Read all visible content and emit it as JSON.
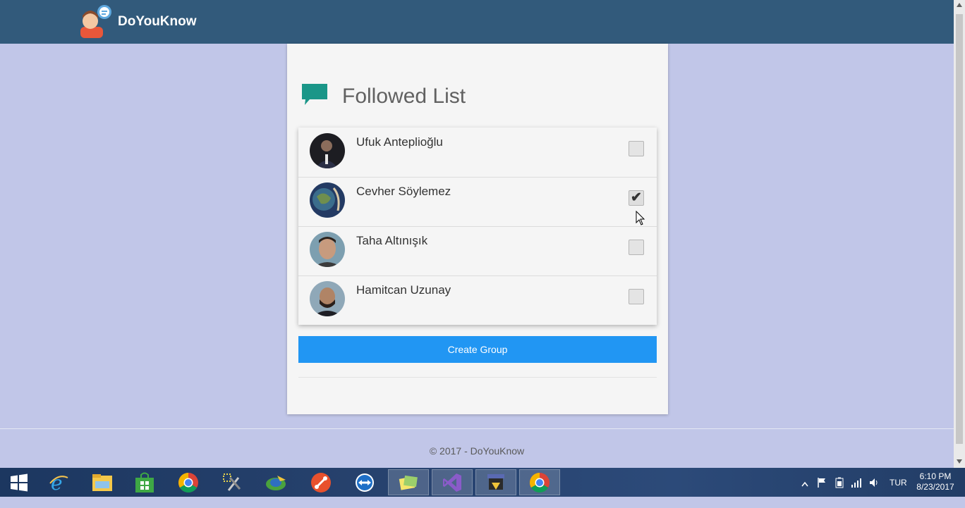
{
  "app": {
    "brand": "DoYouKnow"
  },
  "card": {
    "title": "Followed List",
    "people": [
      {
        "name": "Ufuk Anteplioğlu",
        "checked": false
      },
      {
        "name": "Cevher Söylemez",
        "checked": true
      },
      {
        "name": "Taha Altınışık",
        "checked": false
      },
      {
        "name": "Hamitcan Uzunay",
        "checked": false
      }
    ],
    "create_label": "Create Group"
  },
  "footer": {
    "text": "© 2017 - DoYouKnow"
  },
  "taskbar": {
    "apps": [
      "windows-start-icon",
      "internet-explorer-icon",
      "file-explorer-icon",
      "store-icon",
      "chrome-icon",
      "tools-icon",
      "media-icon",
      "git-icon",
      "teamviewer-icon",
      "sticky-notes-icon",
      "visual-studio-icon",
      "movie-app-icon",
      "chrome-icon"
    ],
    "language": "TUR",
    "time": "6:10 PM",
    "date": "8/23/2017"
  },
  "colors": {
    "header": "#325a7b",
    "background": "#c1c6e8",
    "accent": "#2196f3",
    "chat_icon": "#1a9688"
  }
}
